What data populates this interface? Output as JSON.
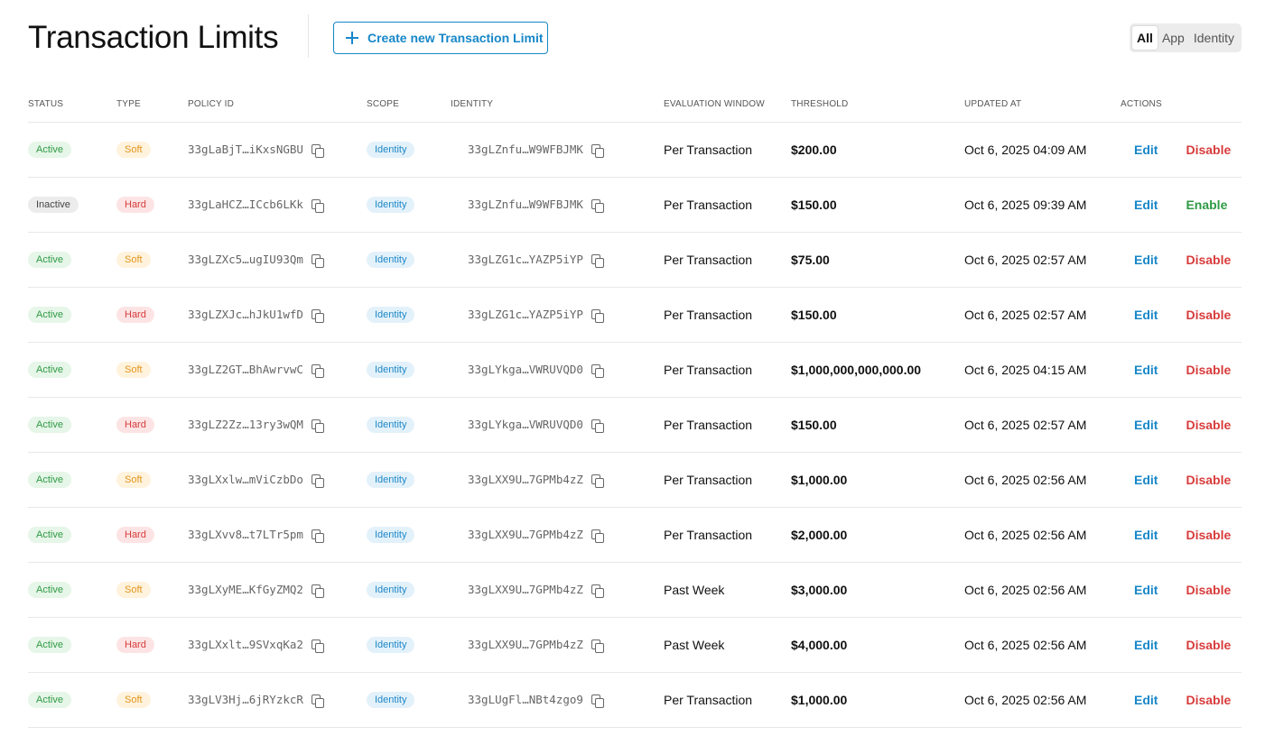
{
  "page": {
    "title": "Transaction Limits",
    "create_button_label": "Create new Transaction Limit",
    "filters": [
      "All",
      "App",
      "Identity"
    ],
    "active_filter": "All"
  },
  "table": {
    "columns": [
      "STATUS",
      "TYPE",
      "POLICY ID",
      "SCOPE",
      "IDENTITY",
      "EVALUATION WINDOW",
      "THRESHOLD",
      "UPDATED AT",
      "ACTIONS"
    ],
    "rows": [
      {
        "status": "Active",
        "type": "Soft",
        "policy_id": "33gLaBjT…iKxsNGBU",
        "scope": "Identity",
        "identity": "33gLZnfu…W9WFBJMK",
        "window": "Per Transaction",
        "threshold": "$200.00",
        "updated": "Oct 6, 2025 04:09 AM",
        "edit": "Edit",
        "toggle": "Disable"
      },
      {
        "status": "Inactive",
        "type": "Hard",
        "policy_id": "33gLaHCZ…ICcb6LKk",
        "scope": "Identity",
        "identity": "33gLZnfu…W9WFBJMK",
        "window": "Per Transaction",
        "threshold": "$150.00",
        "updated": "Oct 6, 2025 09:39 AM",
        "edit": "Edit",
        "toggle": "Enable"
      },
      {
        "status": "Active",
        "type": "Soft",
        "policy_id": "33gLZXc5…ugIU93Qm",
        "scope": "Identity",
        "identity": "33gLZG1c…YAZP5iYP",
        "window": "Per Transaction",
        "threshold": "$75.00",
        "updated": "Oct 6, 2025 02:57 AM",
        "edit": "Edit",
        "toggle": "Disable"
      },
      {
        "status": "Active",
        "type": "Hard",
        "policy_id": "33gLZXJc…hJkU1wfD",
        "scope": "Identity",
        "identity": "33gLZG1c…YAZP5iYP",
        "window": "Per Transaction",
        "threshold": "$150.00",
        "updated": "Oct 6, 2025 02:57 AM",
        "edit": "Edit",
        "toggle": "Disable"
      },
      {
        "status": "Active",
        "type": "Soft",
        "policy_id": "33gLZ2GT…BhAwrvwC",
        "scope": "Identity",
        "identity": "33gLYkga…VWRUVQD0",
        "window": "Per Transaction",
        "threshold": "$1,000,000,000,000.00",
        "updated": "Oct 6, 2025 04:15 AM",
        "edit": "Edit",
        "toggle": "Disable"
      },
      {
        "status": "Active",
        "type": "Hard",
        "policy_id": "33gLZ2Zz…13ry3wQM",
        "scope": "Identity",
        "identity": "33gLYkga…VWRUVQD0",
        "window": "Per Transaction",
        "threshold": "$150.00",
        "updated": "Oct 6, 2025 02:57 AM",
        "edit": "Edit",
        "toggle": "Disable"
      },
      {
        "status": "Active",
        "type": "Soft",
        "policy_id": "33gLXxlw…mViCzbDo",
        "scope": "Identity",
        "identity": "33gLXX9U…7GPMb4zZ",
        "window": "Per Transaction",
        "threshold": "$1,000.00",
        "updated": "Oct 6, 2025 02:56 AM",
        "edit": "Edit",
        "toggle": "Disable"
      },
      {
        "status": "Active",
        "type": "Hard",
        "policy_id": "33gLXvv8…t7LTr5pm",
        "scope": "Identity",
        "identity": "33gLXX9U…7GPMb4zZ",
        "window": "Per Transaction",
        "threshold": "$2,000.00",
        "updated": "Oct 6, 2025 02:56 AM",
        "edit": "Edit",
        "toggle": "Disable"
      },
      {
        "status": "Active",
        "type": "Soft",
        "policy_id": "33gLXyME…KfGyZMQ2",
        "scope": "Identity",
        "identity": "33gLXX9U…7GPMb4zZ",
        "window": "Past Week",
        "threshold": "$3,000.00",
        "updated": "Oct 6, 2025 02:56 AM",
        "edit": "Edit",
        "toggle": "Disable"
      },
      {
        "status": "Active",
        "type": "Hard",
        "policy_id": "33gLXxlt…9SVxqKa2",
        "scope": "Identity",
        "identity": "33gLXX9U…7GPMb4zZ",
        "window": "Past Week",
        "threshold": "$4,000.00",
        "updated": "Oct 6, 2025 02:56 AM",
        "edit": "Edit",
        "toggle": "Disable"
      },
      {
        "status": "Active",
        "type": "Soft",
        "policy_id": "33gLV3Hj…6jRYzkcR",
        "scope": "Identity",
        "identity": "33gLUgFl…NBt4zgo9",
        "window": "Per Transaction",
        "threshold": "$1,000.00",
        "updated": "Oct 6, 2025 02:56 AM",
        "edit": "Edit",
        "toggle": "Disable"
      }
    ]
  },
  "colors": {
    "accent": "#1787c8",
    "active_green": "#2f9a45",
    "soft_orange": "#e3951b",
    "danger_red": "#d83b3b"
  }
}
